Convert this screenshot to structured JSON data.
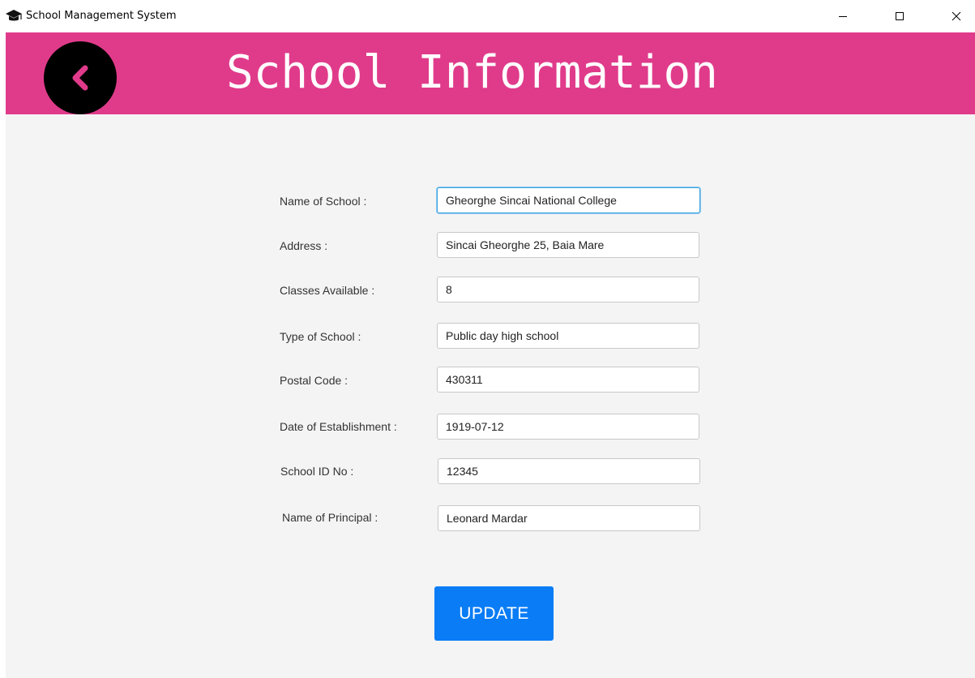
{
  "window": {
    "title": "School Management System",
    "icon": "graduation-cap-icon",
    "controls": [
      "minimize-icon",
      "maximize-icon",
      "close-icon"
    ]
  },
  "header": {
    "title": "School Information",
    "back_icon": "chevron-left-icon",
    "background_color": "#e03b8b"
  },
  "form": {
    "fields": [
      {
        "label": "Name of School :",
        "value": "Gheorghe Sincai National College"
      },
      {
        "label": "Address :",
        "value": "Sincai Gheorghe 25, Baia Mare"
      },
      {
        "label": "Classes Available :",
        "value": "8"
      },
      {
        "label": "Type of School :",
        "value": "Public day high school"
      },
      {
        "label": "Postal Code :",
        "value": "430311"
      },
      {
        "label": "Date of Establishment :",
        "value": "1919-07-12"
      },
      {
        "label": "School ID No :",
        "value": "12345"
      },
      {
        "label": "Name of Principal :",
        "value": "Leonard Mardar"
      }
    ]
  },
  "actions": {
    "update_label": "UPDATE",
    "update_color": "#0a7cf5"
  }
}
